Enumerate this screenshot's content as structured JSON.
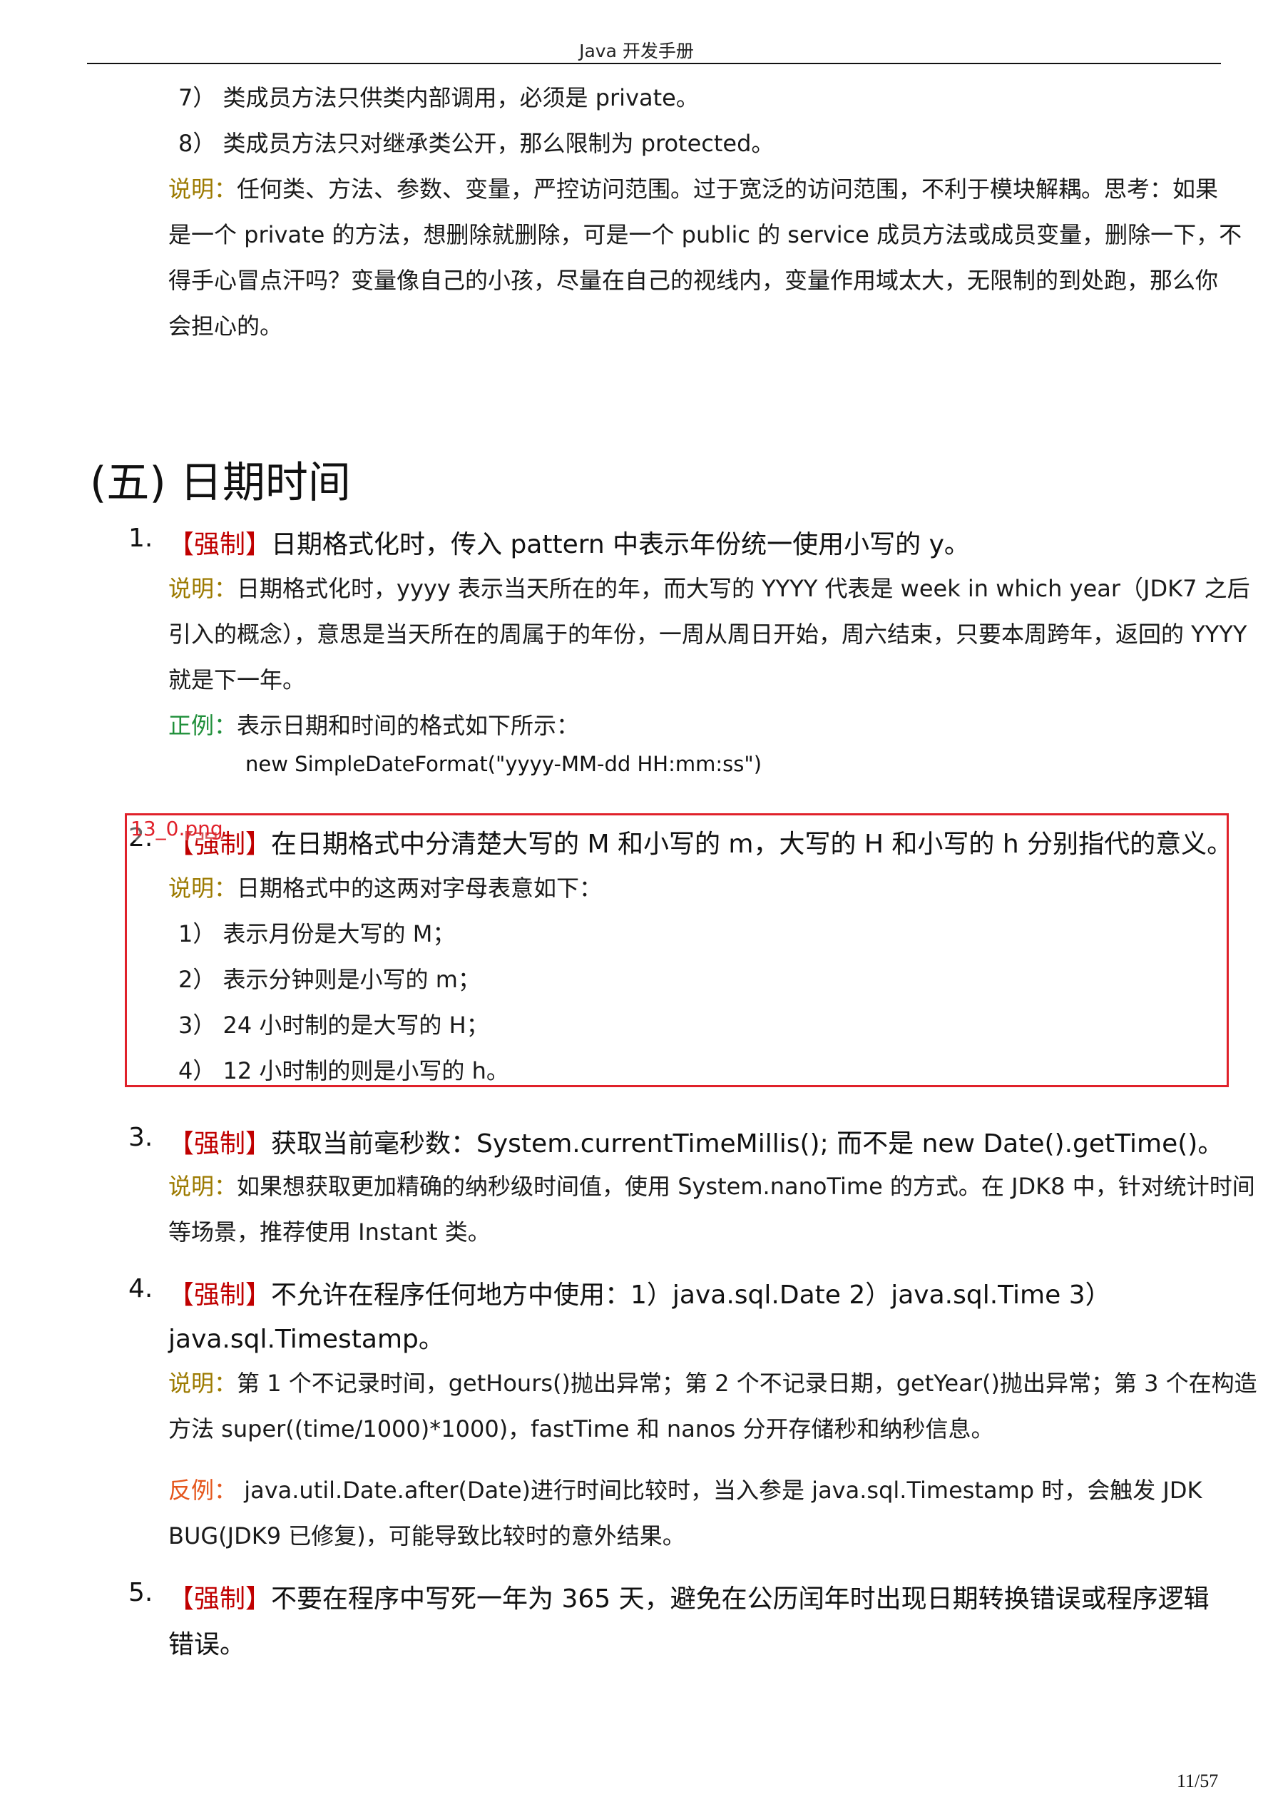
{
  "header": {
    "title": "Java 开发手册"
  },
  "pre_section": {
    "lines": [
      "7） 类成员方法只供类内部调用，必须是 private。",
      "8） 类成员方法只对继承类公开，那么限制为 protected。"
    ],
    "note_label": "说明：",
    "note_lines": [
      "任何类、方法、参数、变量，严控访问范围。过于宽泛的访问范围，不利于模块解耦。思考：如果",
      "是一个 private 的方法，想删除就删除，可是一个 public 的 service 成员方法或成员变量，删除一下，不",
      "得手心冒点汗吗？变量像自己的小孩，尽量在自己的视线内，变量作用域太大，无限制的到处跑，那么你",
      "会担心的。"
    ]
  },
  "section": {
    "title": "(五)  日期时间"
  },
  "items": [
    {
      "num": "1.",
      "tag": "【强制】",
      "title": "日期格式化时，传入 pattern 中表示年份统一使用小写的 y。",
      "note_label": "说明：",
      "note_lines": [
        "日期格式化时，yyyy 表示当天所在的年，而大写的 YYYY 代表是 week in which year（JDK7 之后",
        "引入的概念），意思是当天所在的周属于的年份，一周从周日开始，周六结束，只要本周跨年，返回的 YYYY",
        "就是下一年。"
      ],
      "good_label": "正例：",
      "good_text": "表示日期和时间的格式如下所示：",
      "code": "new SimpleDateFormat(\"yyyy-MM-dd HH:mm:ss\")"
    },
    {
      "num": "2.",
      "tag": "【强制】",
      "title": "在日期格式中分清楚大写的 M 和小写的 m，大写的 H 和小写的 h 分别指代的意义。",
      "note_label": "说明：",
      "note_text": "日期格式中的这两对字母表意如下：",
      "sub_lines": [
        "1） 表示月份是大写的 M；",
        "2） 表示分钟则是小写的 m；",
        "3） 24 小时制的是大写的 H；",
        "4） 12 小时制的则是小写的 h。"
      ]
    },
    {
      "num": "3.",
      "tag": "【强制】",
      "title": "获取当前毫秒数：System.currentTimeMillis(); 而不是 new Date().getTime()。",
      "note_label": "说明：",
      "note_lines": [
        "如果想获取更加精确的纳秒级时间值，使用 System.nanoTime 的方式。在 JDK8 中，针对统计时间",
        "等场景，推荐使用 Instant 类。"
      ]
    },
    {
      "num": "4.",
      "tag": "【强制】",
      "title": "不允许在程序任何地方中使用：1）java.sql.Date 2）java.sql.Time 3）",
      "title_cont": "java.sql.Timestamp。",
      "note_label": "说明：",
      "note_lines": [
        "第 1 个不记录时间，getHours()抛出异常；第 2 个不记录日期，getYear()抛出异常；第 3 个在构造",
        "方法 super((time/1000)*1000)，fastTime 和 nanos 分开存储秒和纳秒信息。"
      ],
      "bad_label": "反例：",
      "bad_lines": [
        " java.util.Date.after(Date)进行时间比较时，当入参是 java.sql.Timestamp 时，会触发 JDK",
        "BUG(JDK9 已修复)，可能导致比较时的意外结果。"
      ]
    },
    {
      "num": "5.",
      "tag": "【强制】",
      "title": "不要在程序中写死一年为 365 天，避免在公历闰年时出现日期转换错误或程序逻辑",
      "title_cont": "错误。"
    }
  ],
  "overlay": {
    "label": "13_0.png",
    "color": "#e0212a"
  },
  "footer": {
    "page": "11/57"
  }
}
